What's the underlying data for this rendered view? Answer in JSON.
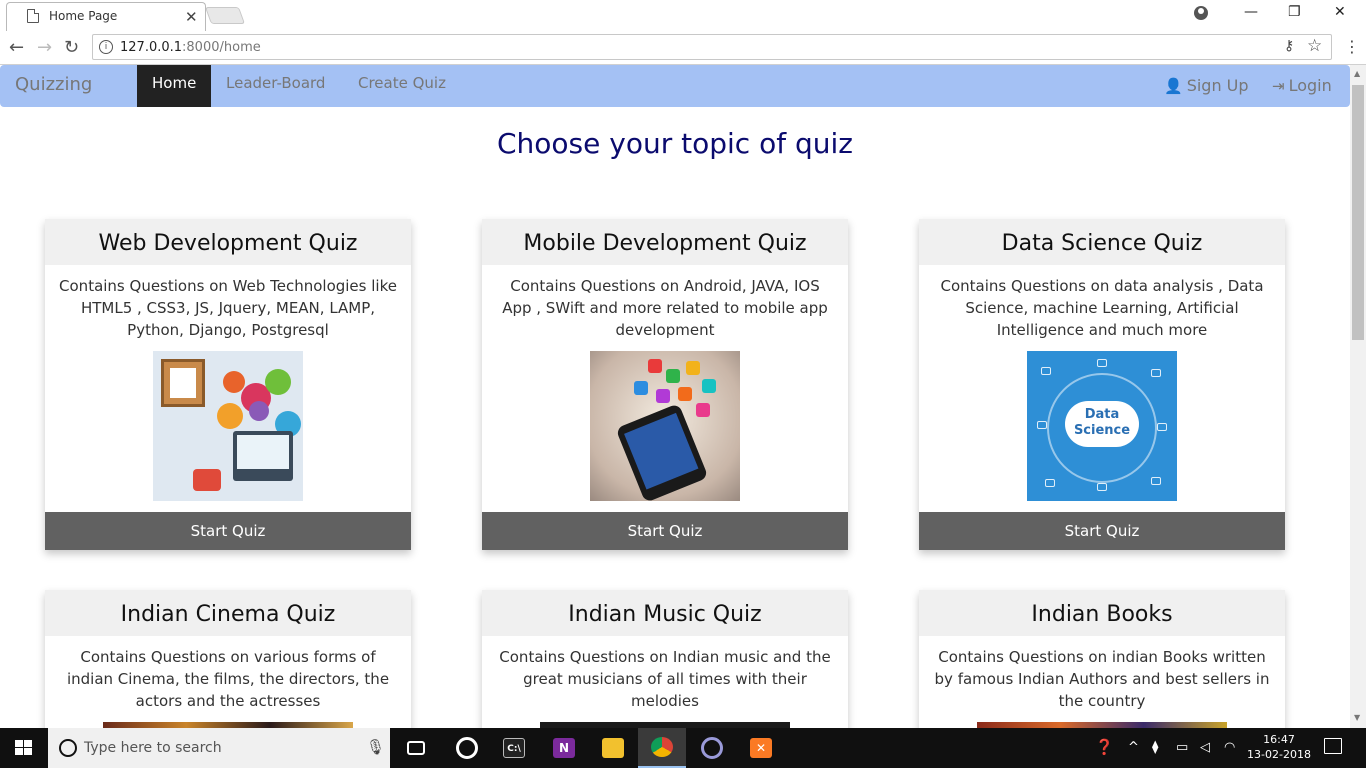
{
  "browser": {
    "tab_title": "Home Page",
    "tab_close": "✕",
    "url_host": "127.0.0.1",
    "url_path": ":8000/home",
    "minimize": "—",
    "maximize": "❐",
    "close": "✕"
  },
  "navbar": {
    "brand": "Quizzing",
    "items": [
      {
        "label": "Home",
        "active": true
      },
      {
        "label": "Leader-Board",
        "active": false
      },
      {
        "label": "Create Quiz",
        "active": false
      }
    ],
    "signup": "Sign Up",
    "login": "Login",
    "colors": {
      "bar": "#a4c1f4",
      "active": "#222222"
    }
  },
  "page": {
    "heading": "Choose your topic of quiz",
    "cards": [
      {
        "title": "Web Development Quiz",
        "description": "Contains Questions on Web Technologies like HTML5 , CSS3, JS, Jquery, MEAN, LAMP, Python, Django, Postgresql",
        "button": "Start Quiz",
        "image": "web-development-illustration"
      },
      {
        "title": "Mobile Development Quiz",
        "description": "Contains Questions on Android, JAVA, IOS App , SWift and more related to mobile app development",
        "button": "Start Quiz",
        "image": "smartphone-apps-illustration"
      },
      {
        "title": "Data Science Quiz",
        "description": "Contains Questions on data analysis , Data Science, machine Learning, Artificial Intelligence and much more",
        "button": "Start Quiz",
        "image": "data-science-cloud-illustration",
        "image_text": "Data Science"
      },
      {
        "title": "Indian Cinema Quiz",
        "description": "Contains Questions on various forms of indian Cinema, the films, the directors, the actors and the actresses"
      },
      {
        "title": "Indian Music Quiz",
        "description": "Contains Questions on Indian music and the great musicians of all times with their melodies"
      },
      {
        "title": "Indian Books",
        "description": "Contains Questions on indian Books written by famous Indian Authors and best sellers in the country"
      }
    ]
  },
  "taskbar": {
    "search_placeholder": "Type here to search",
    "time": "16:47",
    "date": "13-02-2018",
    "apps": [
      "task-view",
      "groove",
      "cmd",
      "onenote",
      "file-explorer",
      "chrome",
      "cortana-ring",
      "xampp"
    ]
  }
}
